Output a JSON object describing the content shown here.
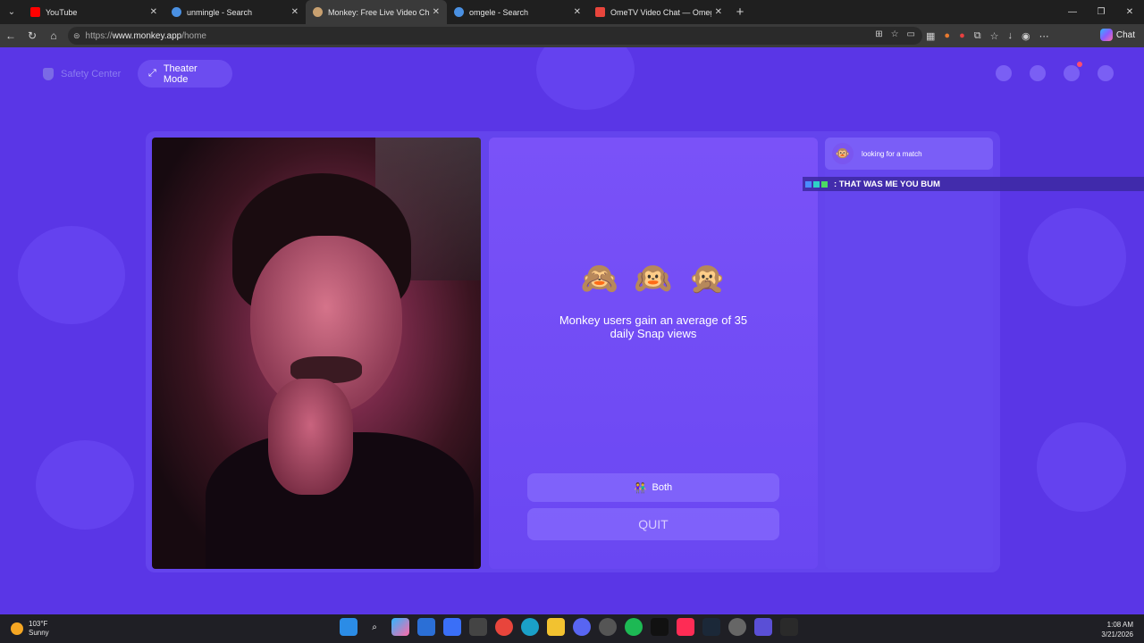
{
  "browser": {
    "tabs": [
      {
        "title": "YouTube",
        "favicon_color": "#ff0000",
        "active": false
      },
      {
        "title": "unmingle - Search",
        "favicon_color": "#4a90e2",
        "active": false
      },
      {
        "title": "Monkey: Free Live Video Chat",
        "favicon_color": "#c8a070",
        "active": true
      },
      {
        "title": "omgele - Search",
        "favicon_color": "#4a90e2",
        "active": false
      },
      {
        "title": "OmeTV Video Chat — Omegle Ra",
        "favicon_color": "#e8453c",
        "active": false
      }
    ],
    "url_prefix": "https://",
    "url_host": "www.monkey.app",
    "url_path": "/home",
    "chat_label": "Chat"
  },
  "page": {
    "safety_center": "Safety Center",
    "theater_mode": "Theater Mode",
    "emojis": [
      "🙈",
      "🙉",
      "🙊"
    ],
    "tagline": "Monkey users gain an average of 35 daily Snap views",
    "both_emoji": "👫",
    "both_label": "Both",
    "quit_label": "QUIT",
    "match_status": "looking for a match",
    "match_avatar": "🐵",
    "overlay_user": "",
    "overlay_message": ": THAT WAS ME YOU BUM"
  },
  "taskbar": {
    "temperature": "103°F",
    "condition": "Sunny",
    "time": "1:08 AM",
    "date": "3/21/2026"
  },
  "colors": {
    "page_bg": "#5a36e6",
    "accent": "#7a52f8",
    "overlay_user": "#e0106a"
  }
}
